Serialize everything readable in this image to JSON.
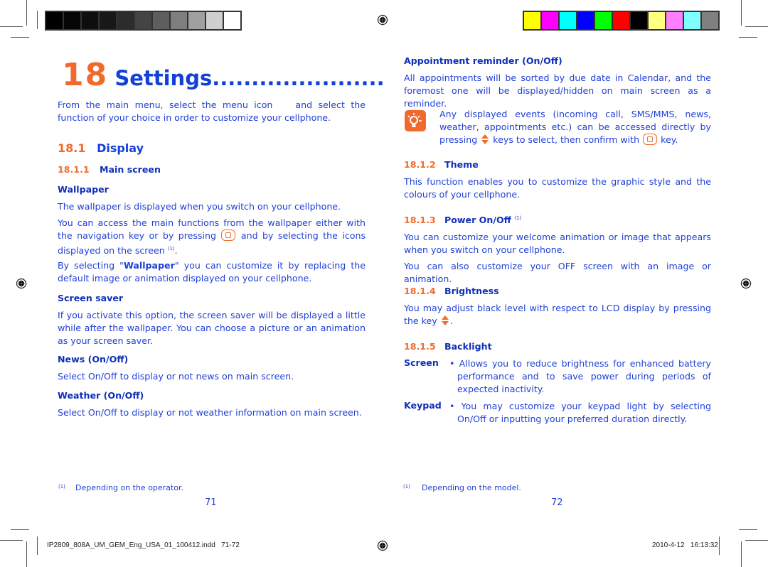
{
  "color_bars": {
    "gray": [
      "#000000",
      "#050505",
      "#0e0e0e",
      "#181818",
      "#2c2c2c",
      "#444444",
      "#5e5e5e",
      "#7e7e7e",
      "#a0a0a0",
      "#cfcfcf",
      "#ffffff"
    ],
    "color": [
      "#ffff00",
      "#ff00ff",
      "#00ffff",
      "#0000ff",
      "#00ff00",
      "#ff0000",
      "#000000",
      "#ffff80",
      "#ff80ff",
      "#80ffff",
      "#808080"
    ]
  },
  "left_page": {
    "chapter_number": "18",
    "chapter_title": "Settings......................",
    "intro_part1": "From the main menu, select the menu icon",
    "intro_part2": "and select the function of your choice in order to customize your cellphone.",
    "section_number": "18.1",
    "section_title": "Display",
    "subsection_number": "18.1.1",
    "subsection_title": "Main screen",
    "wallpaper_heading": "Wallpaper",
    "wallpaper_p1": "The wallpaper is displayed when you switch on your cellphone.",
    "wallpaper_p2a": "You can access the main functions from the wallpaper either with the navigation key or by pressing",
    "wallpaper_p2b": "and by selecting the icons displayed on the screen",
    "wallpaper_p2_sup": "(1)",
    "wallpaper_p3a": "By selecting \"",
    "wallpaper_p3_bold": "Wallpaper",
    "wallpaper_p3b": "\" you can customize it by replacing the default image or animation displayed on your cellphone.",
    "screensaver_heading": "Screen saver",
    "screensaver_p": "If you activate this option, the screen saver will be displayed a little while after the wallpaper. You can choose a picture or an animation as your screen saver.",
    "news_heading": "News (On/Off)",
    "news_p": "Select On/Off to display or not news on main screen.",
    "weather_heading": "Weather (On/Off)",
    "weather_p": "Select On/Off to display or not weather information on main screen.",
    "footnote_marker": "(1)",
    "footnote": "Depending on the operator.",
    "page_number": "71"
  },
  "right_page": {
    "appointment_heading": "Appointment reminder (On/Off)",
    "appointment_p": "All appointments will be sorted by due date in Calendar, and the foremost one will be displayed/hidden on main screen as a reminder.",
    "tip_p1": "Any displayed events (incoming call, SMS/MMS, news, weather, appointments  etc.) can be accessed directly by pressing",
    "tip_p2": "keys to select, then confirm with",
    "tip_p3": "key.",
    "theme_number": "18.1.2",
    "theme_title": "Theme",
    "theme_p": "This function enables you to customize the graphic style and the colours of your cellphone.",
    "power_number": "18.1.3",
    "power_title": "Power On/Off",
    "power_sup": "(1)",
    "power_p1": "You can customize your welcome animation or image that appears when you switch on your cellphone.",
    "power_p2": "You can also customize your OFF screen with an image or animation.",
    "brightness_number": "18.1.4",
    "brightness_title": "Brightness",
    "brightness_p1": "You may adjust black level with respect to LCD display by pressing the key",
    "brightness_p2": ".",
    "backlight_number": "18.1.5",
    "backlight_title": "Backlight",
    "backlight_items": [
      {
        "label": "Screen",
        "text": "• Allows you to reduce brightness for enhanced battery performance and to save power during periods of expected inactivity."
      },
      {
        "label": "Keypad",
        "text": "• You may customize your keypad light by selecting On/Off or inputting your preferred duration directly."
      }
    ],
    "footnote_marker": "(1)",
    "footnote": "Depending on the model.",
    "page_number": "72"
  },
  "slug": {
    "file": "IP2809_808A_UM_GEM_Eng_USA_01_100412.indd   71-72",
    "timestamp": "2010-4-12   16:13:32"
  }
}
